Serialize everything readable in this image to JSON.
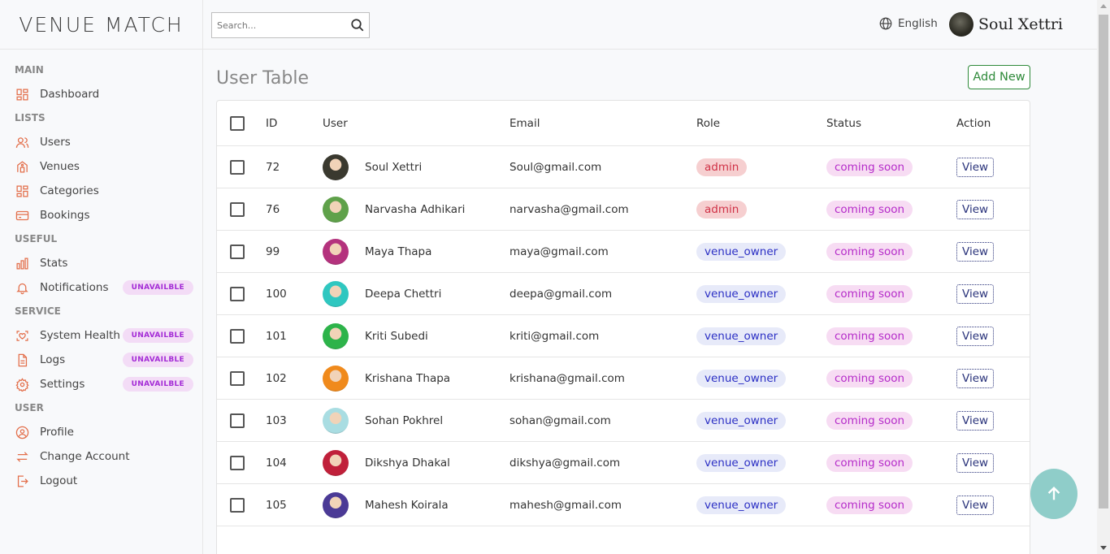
{
  "brand": {
    "logo_text": "VENUE MATCH"
  },
  "search": {
    "placeholder": "Search..."
  },
  "topbar": {
    "language": "English",
    "user_name": "Soul Xettri"
  },
  "sidebar": {
    "sections": [
      {
        "title": "MAIN",
        "items": [
          {
            "label": "Dashboard",
            "icon": "grid-icon"
          }
        ]
      },
      {
        "title": "LISTS",
        "items": [
          {
            "label": "Users",
            "icon": "users-icon"
          },
          {
            "label": "Venues",
            "icon": "venue-icon"
          },
          {
            "label": "Categories",
            "icon": "grid-icon"
          },
          {
            "label": "Bookings",
            "icon": "card-icon"
          }
        ]
      },
      {
        "title": "USEFUL",
        "items": [
          {
            "label": "Stats",
            "icon": "bar-chart-icon"
          },
          {
            "label": "Notifications",
            "icon": "bell-icon",
            "badge": "UNAVAILBLE"
          }
        ]
      },
      {
        "title": "SERVICE",
        "items": [
          {
            "label": "System Health",
            "icon": "health-icon",
            "badge": "UNAVAILBLE"
          },
          {
            "label": "Logs",
            "icon": "log-icon",
            "badge": "UNAVAILBLE"
          },
          {
            "label": "Settings",
            "icon": "gear-icon",
            "badge": "UNAVAILBLE"
          }
        ]
      },
      {
        "title": "USER",
        "items": [
          {
            "label": "Profile",
            "icon": "profile-icon"
          },
          {
            "label": "Change Account",
            "icon": "swap-icon"
          },
          {
            "label": "Logout",
            "icon": "logout-icon"
          }
        ]
      }
    ]
  },
  "main": {
    "title": "User Table",
    "add_button": "Add New",
    "columns": [
      "ID",
      "User",
      "Email",
      "Role",
      "Status",
      "Action"
    ],
    "rows": [
      {
        "id": "72",
        "name": "Soul Xettri",
        "email": "Soul@gmail.com",
        "role": "admin",
        "status": "coming soon",
        "action": "View",
        "avatar_color": "#3a392f"
      },
      {
        "id": "76",
        "name": "Narvasha Adhikari",
        "email": "narvasha@gmail.com",
        "role": "admin",
        "status": "coming soon",
        "action": "View",
        "avatar_color": "#5fa14a"
      },
      {
        "id": "99",
        "name": "Maya Thapa",
        "email": "maya@gmail.com",
        "role": "venue_owner",
        "status": "coming soon",
        "action": "View",
        "avatar_color": "#b4327d"
      },
      {
        "id": "100",
        "name": "Deepa Chettri",
        "email": "deepa@gmail.com",
        "role": "venue_owner",
        "status": "coming soon",
        "action": "View",
        "avatar_color": "#2fc7c0"
      },
      {
        "id": "101",
        "name": "Kriti Subedi",
        "email": "kriti@gmail.com",
        "role": "venue_owner",
        "status": "coming soon",
        "action": "View",
        "avatar_color": "#2db34a"
      },
      {
        "id": "102",
        "name": "Krishana Thapa",
        "email": "krishana@gmail.com",
        "role": "venue_owner",
        "status": "coming soon",
        "action": "View",
        "avatar_color": "#f08a1c"
      },
      {
        "id": "103",
        "name": "Sohan Pokhrel",
        "email": "sohan@gmail.com",
        "role": "venue_owner",
        "status": "coming soon",
        "action": "View",
        "avatar_color": "#a9dde2"
      },
      {
        "id": "104",
        "name": "Dikshya Dhakal",
        "email": "dikshya@gmail.com",
        "role": "venue_owner",
        "status": "coming soon",
        "action": "View",
        "avatar_color": "#c0203a"
      },
      {
        "id": "105",
        "name": "Mahesh Koirala",
        "email": "mahesh@gmail.com",
        "role": "venue_owner",
        "status": "coming soon",
        "action": "View",
        "avatar_color": "#4b3a96"
      }
    ]
  },
  "colors": {
    "accent": "#e36f4b",
    "badge_unavailable": "#a42cd6",
    "admin": "#d03247",
    "venue_owner": "#2b2fc4",
    "coming_soon": "#b52bc9",
    "add_button": "#2f8a3a",
    "fab": "#8fcdc9"
  }
}
